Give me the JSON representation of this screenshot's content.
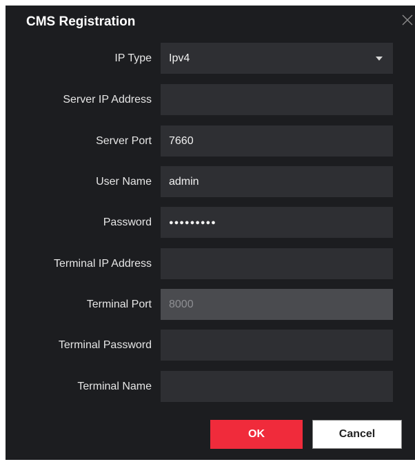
{
  "dialog": {
    "title": "CMS Registration",
    "close_icon": "close-icon"
  },
  "fields": [
    {
      "label": "IP Type",
      "value": "Ipv4",
      "type": "select"
    },
    {
      "label": "Server IP Address",
      "value": "",
      "type": "text"
    },
    {
      "label": "Server Port",
      "value": "7660",
      "type": "text"
    },
    {
      "label": "User Name",
      "value": "admin",
      "type": "text"
    },
    {
      "label": "Password",
      "value": "●●●●●●●●●",
      "type": "password"
    },
    {
      "label": "Terminal IP Address",
      "value": "",
      "type": "text"
    },
    {
      "label": "Terminal Port",
      "value": "8000",
      "type": "disabled"
    },
    {
      "label": "Terminal Password",
      "value": "",
      "type": "text"
    },
    {
      "label": "Terminal Name",
      "value": "",
      "type": "text"
    }
  ],
  "buttons": {
    "ok_label": "OK",
    "cancel_label": "Cancel"
  },
  "colors": {
    "background": "#1c1d20",
    "field": "#2e2f33",
    "field_disabled": "#4a4b4f",
    "accent": "#f02b3b"
  }
}
